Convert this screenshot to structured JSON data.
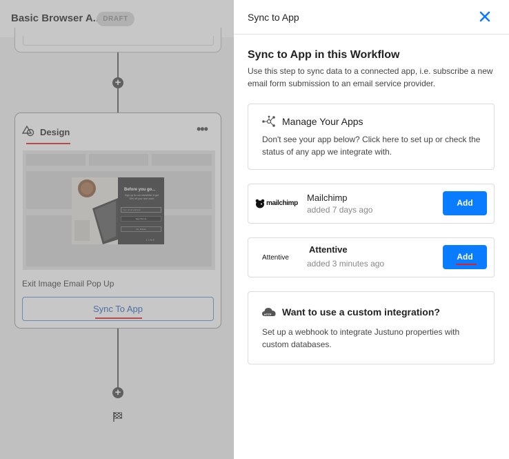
{
  "workflow": {
    "title": "Basic Browser A...",
    "status_badge": "DRAFT",
    "design_step": {
      "title": "Design",
      "step_label": "Exit Image Email Pop Up",
      "sync_button": "Sync To App",
      "popup": {
        "headline": "Before you go...",
        "subtext": "Sign up for our newsletter & get 15% off your next order.",
        "email_placeholder": "Your email address",
        "signup_button": "Sign Me Up",
        "secondary_button": "No, thanks",
        "brand": "L I N E"
      }
    }
  },
  "panel": {
    "title": "Sync to App",
    "heading": "Sync to App in this Workflow",
    "description": "Use this step to sync data to a connected app, i.e. subscribe a new email form submission to an email service provider.",
    "manage_apps": {
      "title": "Manage Your Apps",
      "description": "Don't see your app below? Click here to set up or check the status of any app we integrate with."
    },
    "apps": [
      {
        "logo_text": "mailchimp",
        "name": "Mailchimp",
        "added": "added 7 days ago",
        "button": "Add"
      },
      {
        "logo_text": "Attentive",
        "name": "Attentive",
        "added": "added 3 minutes ago",
        "button": "Add"
      }
    ],
    "custom_integration": {
      "title": "Want to use a custom integration?",
      "description": "Set up a webhook to integrate Justuno properties with custom databases.",
      "icon_text": "HTTP"
    }
  },
  "colors": {
    "accent": "#0a7cff",
    "annotation_red": "#e02020"
  }
}
